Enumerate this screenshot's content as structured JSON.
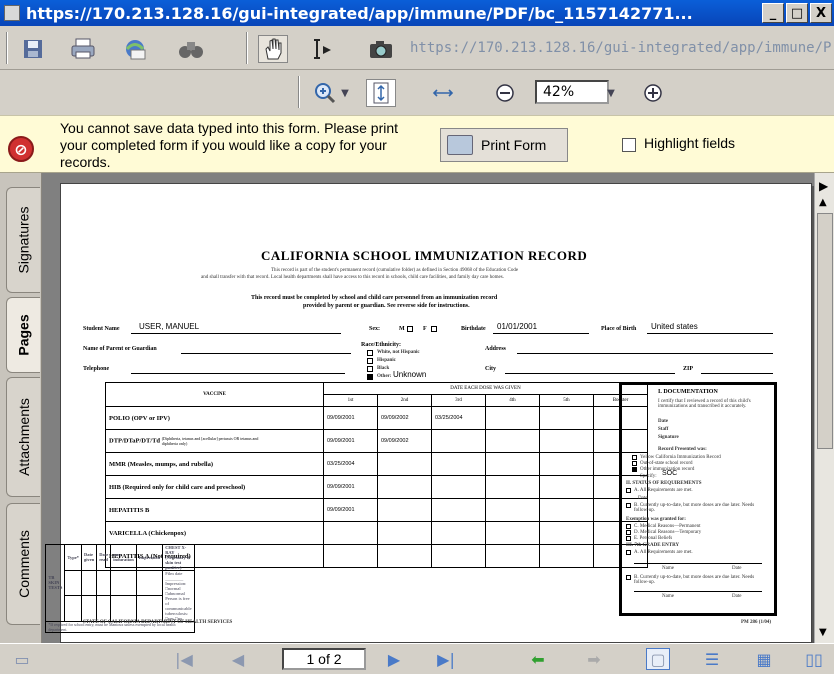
{
  "window": {
    "title": "https://170.213.128.16/gui-integrated/app/immune/PDF/bc_1157142771...",
    "min": "_",
    "max": "□",
    "close": "X"
  },
  "toolbar": {
    "url_ghost": "https://170.213.128.16/gui-integrated/app/immune/P",
    "zoom_value": "42%"
  },
  "notice": {
    "text": "You cannot save data typed into this form. Please print your completed form if you would like a copy for your records.",
    "print_label": "Print Form",
    "highlight_label": "Highlight fields"
  },
  "sidebar": {
    "tabs": [
      {
        "label": "Signatures"
      },
      {
        "label": "Pages"
      },
      {
        "label": "Attachments"
      },
      {
        "label": "Comments"
      }
    ]
  },
  "status": {
    "page_indicator": "1 of 2"
  },
  "form": {
    "title": "CALIFORNIA SCHOOL IMMUNIZATION RECORD",
    "subtitle1": "This record is part of the student's permanent record (cumulative folder) as defined in Section 49068 of the Education Code",
    "subtitle2": "and shall transfer with that record. Local health departments shall have access to this record in schools, child care facilities, and family day care homes.",
    "instructions1": "This record must be completed by school and child care personnel from an immunization record",
    "instructions2": "provided by parent or guardian. See reverse side for instructions.",
    "student_name_label": "Student Name",
    "student_name": "USER, MANUEL",
    "sex_label": "Sex:",
    "sex_m": "M",
    "sex_f": "F",
    "birthdate_label": "Birthdate",
    "birthdate": "01/01/2001",
    "pob_label": "Place of Birth",
    "pob": "United states",
    "parent_label": "Name of Parent or Guardian",
    "race_label": "Race/Ethnicity:",
    "race_options": [
      "White, not Hispanic",
      "Hispanic",
      "Black"
    ],
    "race_other_label": "Other:",
    "race_other": "Unknown",
    "address_label": "Address",
    "telephone_label": "Telephone",
    "city_label": "City",
    "zip_label": "ZIP",
    "vaccine_header": "VACCINE",
    "dates_header": "DATE EACH DOSE WAS GIVEN",
    "dose_headers": [
      "1st",
      "2nd",
      "3rd",
      "4th",
      "5th",
      "Booster"
    ],
    "vaccines": [
      {
        "name": "POLIO  (OPV or IPV)",
        "note": "",
        "doses": [
          "09/09/2001",
          "09/09/2002",
          "03/25/2004",
          "",
          "",
          ""
        ]
      },
      {
        "name": "DTP/DTaP/DT/Td",
        "note": "(Diphtheria, tetanus and [acellular] pertussis OR tetanus and diphtheria only)",
        "doses": [
          "09/09/2001",
          "09/09/2002",
          "",
          "",
          "",
          ""
        ]
      },
      {
        "name": "MMR  (Measles, mumps, and rubella)",
        "note": "",
        "doses": [
          "03/25/2004",
          "",
          "",
          "",
          "",
          ""
        ]
      },
      {
        "name": "HIB  (Required only for child care and preschool)",
        "note": "",
        "doses": [
          "09/09/2001",
          "",
          "",
          "",
          "",
          ""
        ]
      },
      {
        "name": "HEPATITIS  B",
        "note": "",
        "doses": [
          "09/09/2001",
          "",
          "",
          "",
          "",
          ""
        ]
      },
      {
        "name": "VARICELLA  (Chickenpox)",
        "note": "",
        "doses": [
          "",
          "",
          "",
          "",
          "",
          ""
        ]
      },
      {
        "name": "HEPATITIS  A  (Not required)",
        "note": "",
        "doses": [
          "",
          "",
          "",
          "",
          "",
          ""
        ]
      }
    ],
    "doc": {
      "title": "I. DOCUMENTATION",
      "certify": "I certify that I reviewed a record of this child's immunizations and transcribed it accurately.",
      "date": "Date",
      "staff": "Staff",
      "signature": "Signature",
      "presented": "Record Presented was:",
      "options": [
        "Yellow California Immunization Record",
        "Out-of-state school record",
        "Other immunization record"
      ],
      "specify_label": "Specify:",
      "specify": "SOC",
      "status_title": "II. STATUS OF REQUIREMENTS",
      "status_a": "A. All Requirements are met.",
      "status_date": "Date",
      "status_b": "B. Currently up-to-date, but more doses are due later. Needs follow-up.",
      "exemption": "Exemption was granted for:",
      "exempt_options": [
        "C. Medical Reasons—Permanent",
        "D. Medical Reasons—Temporary",
        "E. Personal Beliefs"
      ],
      "grade_title": "III. 7th GRADE ENTRY",
      "grade_a": "A. All Requirements are met.",
      "name_label": "Name",
      "date_label": "Date",
      "grade_b": "B. Currently up-to-date, but more doses are due later. Needs follow-up."
    },
    "tb": {
      "label": "TB SKIN TESTS",
      "type_hdr": "Type*",
      "given_hdr": "Date given",
      "read_hdr": "Date read",
      "mm_hdr": "mm induration",
      "imp_hdr": "Impression",
      "chest_hdr": "CHEST X-RAY (Necessary if skin test positive)",
      "film": "Film date",
      "impression": "Impression:",
      "normal": "normal",
      "abnormal": "abnormal",
      "persons": "Person is free of communicable tuberculosis:",
      "yes": "yes",
      "no": "no",
      "footnote": "*If required for school entry, must be Mantoux unless exempted by local health department."
    },
    "footer_left": "STATE OF CALIFORNIA DEPARTMENT OF HEALTH SERVICES",
    "footer_right": "PM 286 (1/04)"
  }
}
